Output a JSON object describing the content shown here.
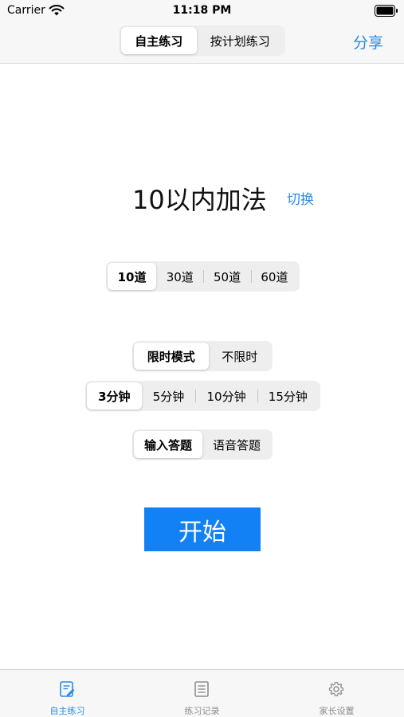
{
  "status_bar": {
    "carrier": "Carrier",
    "time": "11:18 PM"
  },
  "nav": {
    "segments": [
      "自主练习",
      "按计划练习"
    ],
    "selected_segment": "自主练习",
    "share_label": "分享"
  },
  "main": {
    "title": "10以内加法",
    "switch_label": "切换",
    "question_counts": [
      "10道",
      "30道",
      "50道",
      "60道"
    ],
    "question_count_selected": "10道",
    "modes": [
      "限时模式",
      "不限时"
    ],
    "mode_selected": "限时模式",
    "time_limits": [
      "3分钟",
      "5分钟",
      "10分钟",
      "15分钟"
    ],
    "time_limit_selected": "3分钟",
    "answer_methods": [
      "输入答题",
      "语音答题"
    ],
    "answer_method_selected": "输入答题",
    "start_label": "开始"
  },
  "tab_bar": {
    "tabs": [
      {
        "label": "自主练习",
        "icon": "practice-icon",
        "active": true
      },
      {
        "label": "练习记录",
        "icon": "record-list-icon",
        "active": false
      },
      {
        "label": "家长设置",
        "icon": "gear-icon",
        "active": false
      }
    ]
  },
  "colors": {
    "accent": "#2a8ae6",
    "start_button": "#1181f5",
    "inactive_tab": "#8e8e93"
  }
}
